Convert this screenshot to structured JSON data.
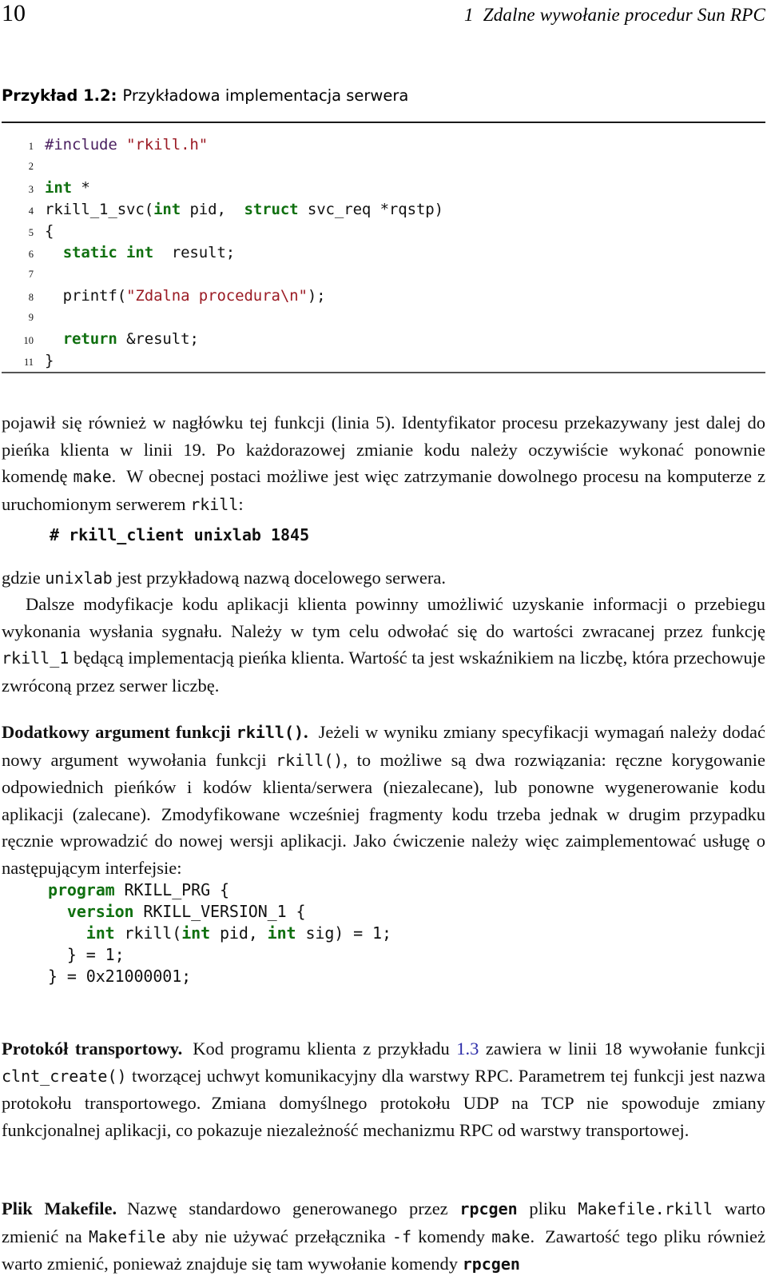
{
  "page": {
    "folio": "10",
    "chapter_number": "1",
    "chapter_title": "Zdalne wywołanie procedur Sun RPC"
  },
  "caption": {
    "label": "Przykład 1.2:",
    "description": "Przykładowa implementacja serwera"
  },
  "listing_server": {
    "lines": [
      {
        "n": "1",
        "segments": [
          {
            "t": "#include ",
            "c": "pre"
          },
          {
            "t": "\"rkill.h\"",
            "c": "str"
          }
        ]
      },
      {
        "n": "2",
        "segments": [
          {
            "t": "",
            "c": "plain"
          }
        ]
      },
      {
        "n": "3",
        "segments": [
          {
            "t": "int",
            "c": "kw"
          },
          {
            "t": " *",
            "c": "plain"
          }
        ]
      },
      {
        "n": "4",
        "segments": [
          {
            "t": "rkill_1_svc(",
            "c": "plain"
          },
          {
            "t": "int",
            "c": "kw"
          },
          {
            "t": " pid,  ",
            "c": "plain"
          },
          {
            "t": "struct",
            "c": "kw"
          },
          {
            "t": " svc_req *rqstp)",
            "c": "plain"
          }
        ]
      },
      {
        "n": "5",
        "segments": [
          {
            "t": "{",
            "c": "plain"
          }
        ]
      },
      {
        "n": "6",
        "segments": [
          {
            "t": "  ",
            "c": "plain"
          },
          {
            "t": "static int",
            "c": "kw"
          },
          {
            "t": "  result;",
            "c": "plain"
          }
        ]
      },
      {
        "n": "7",
        "segments": [
          {
            "t": "",
            "c": "plain"
          }
        ]
      },
      {
        "n": "8",
        "segments": [
          {
            "t": "  printf(",
            "c": "plain"
          },
          {
            "t": "\"Zdalna procedura\\n\"",
            "c": "str"
          },
          {
            "t": ");",
            "c": "plain"
          }
        ]
      },
      {
        "n": "9",
        "segments": [
          {
            "t": "",
            "c": "plain"
          }
        ]
      },
      {
        "n": "10",
        "segments": [
          {
            "t": "  ",
            "c": "plain"
          },
          {
            "t": "return",
            "c": "kw"
          },
          {
            "t": " &result;",
            "c": "plain"
          }
        ]
      },
      {
        "n": "11",
        "segments": [
          {
            "t": "}",
            "c": "plain"
          }
        ]
      }
    ]
  },
  "para_1": {
    "html": "pojawił się również w nagłówku tej funkcji (linia 5). Identyfikator procesu przekazywany jest dalej do pieńka klienta w linii 19.<span class=\"gap\"></span>Po każdorazowej zmianie kodu należy oczywiście wykonać ponownie komendę <span class=\"tt\">make</span>.<span class=\"gap\"></span>W obecnej postaci możliwe jest więc zatrzymanie dowolnego procesu na komputerze z uruchomionym serwerem <span class=\"tt\">rkill</span>:"
  },
  "command_line": {
    "text": "# rkill_client unixlab 1845"
  },
  "para_2": {
    "html": "gdzie <span class=\"tt\">unixlab</span> jest przykładową nazwą docelowego serwera."
  },
  "para_3": {
    "html": "Dalsze modyfikacje kodu aplikacji klienta powinny umożliwić uzyskanie informacji o przebiegu wykonania wysłania sygnału. Należy w tym celu odwołać się do wartości zwracanej przez funkcję <span class=\"tt\">rkill_1</span> będącą implementacją pieńka klienta. Wartość ta jest wskaźnikiem na liczbę, która przechowuje zwróconą przez serwer liczbę."
  },
  "para_4": {
    "heading": "Dodatkowy argument funkcji rkill().",
    "html": "<span class=\"run-in\">Dodatkowy argument funkcji <span class=\"tt\">rkill()</span>.</span><span class=\"gap\"></span>Jeżeli w wyniku zmiany specyfikacji wymagań należy dodać nowy argument wywołania funkcji <span class=\"tt\">rkill()</span>, to możliwe są dwa rozwiązania: ręczne korygowanie odpowiednich pieńków i kodów klienta/serwera (niezalecane), lub ponowne wygenerowanie kodu aplikacji (zalecane).<span class=\"gap\"></span>Zmodyfikowane wcześniej fragmenty kodu trzeba jednak w drugim przypadku ręcznie wprowadzić do nowej wersji aplikacji. Jako ćwiczenie należy więc zaimplementować usługę o następującym interfejsie:"
  },
  "listing_idl": {
    "lines": [
      {
        "segments": [
          {
            "t": "program",
            "c": "kw"
          },
          {
            "t": " RKILL_PRG {",
            "c": "plain"
          }
        ]
      },
      {
        "segments": [
          {
            "t": "  ",
            "c": "plain"
          },
          {
            "t": "version",
            "c": "kw"
          },
          {
            "t": " RKILL_VERSION_1 {",
            "c": "plain"
          }
        ]
      },
      {
        "segments": [
          {
            "t": "    ",
            "c": "plain"
          },
          {
            "t": "int",
            "c": "kw"
          },
          {
            "t": " rkill(",
            "c": "plain"
          },
          {
            "t": "int",
            "c": "kw"
          },
          {
            "t": " pid, ",
            "c": "plain"
          },
          {
            "t": "int",
            "c": "kw"
          },
          {
            "t": " sig) = 1;",
            "c": "plain"
          }
        ]
      },
      {
        "segments": [
          {
            "t": "  } = 1;",
            "c": "plain"
          }
        ]
      },
      {
        "segments": [
          {
            "t": "} = 0x21000001;",
            "c": "plain"
          }
        ]
      }
    ]
  },
  "para_5": {
    "heading": "Protokół transportowy.",
    "html": "<span class=\"run-in\">Protokół transportowy.</span><span class=\"gap\"></span>Kod programu klienta z przykładu <span class=\"link\">1.3</span> zawiera w linii 18 wywołanie funkcji <span class=\"tt\">clnt_create()</span> tworzącej uchwyt komunikacyjny dla warstwy RPC. Parametrem tej funkcji jest nazwa protokołu transportowego.<span class=\"gap\"></span>Zmiana domyślnego protokołu UDP na TCP nie spowoduje zmiany funkcjonalnej aplikacji, co pokazuje niezależność mechanizmu RPC od warstwy transportowej."
  },
  "para_6": {
    "heading": "Plik Makefile.",
    "html": "<span class=\"run-in\">Plik Makefile.</span><span class=\"gap\"></span>Nazwę standardowo generowanego przez <span class=\"tt bf\">rpcgen</span> pliku <span class=\"tt\">Makefile.rkill</span> warto zmienić na <span class=\"tt\">Makefile</span> aby nie używać przełącznika <span class=\"tt\">-f</span> komendy <span class=\"tt\">make</span>.<span class=\"gap\"></span>Zawartość tego pliku również warto zmienić, ponieważ znajduje się tam wywołanie komendy <span class=\"tt bf\">rpcgen</span>"
  },
  "colors": {
    "keyword": "#107010",
    "string": "#9b1b24",
    "preprocessor": "#4b2060",
    "link": "#2c2ca8",
    "rule": "#1a1a1a",
    "text": "#111111"
  }
}
